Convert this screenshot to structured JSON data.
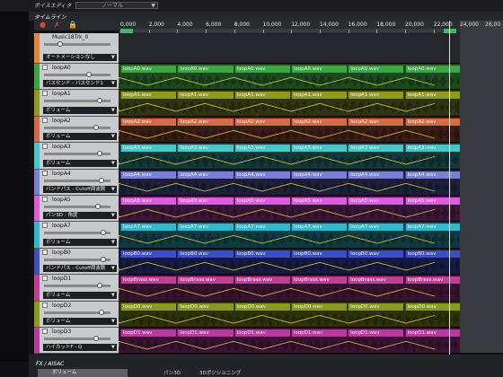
{
  "topbar": {
    "label": "ボイスエディタ",
    "combo_value": "ノーマル"
  },
  "timeline": {
    "title": "タイムライン"
  },
  "ruler": {
    "ticks": [
      "0,000",
      "2,000",
      "4,000",
      "6,000",
      "8,000",
      "10,000",
      "12,000",
      "14,000",
      "16,000",
      "18,000",
      "20,000",
      "22,000",
      "24,000",
      "26,00"
    ]
  },
  "right_ticks": [
    "24,000",
    "26,00"
  ],
  "master": {
    "name": "Music18Trk_0",
    "automation": "オートメーションなし",
    "color": "#e0843a"
  },
  "tracks": [
    {
      "name": "loopA0",
      "param": "バスセンド - バスセンド1",
      "clip": "loopA0.wav",
      "color": "#3aa542",
      "lane_bg": "#1b4a1f"
    },
    {
      "name": "loopA1",
      "param": "ボリューム",
      "clip": "loopA1.wav",
      "color": "#8c9a1e",
      "lane_bg": "#2e3510"
    },
    {
      "name": "loopA2",
      "param": "ボリューム",
      "clip": "loopA2.wav",
      "color": "#d36a4a",
      "lane_bg": "#3b1c16"
    },
    {
      "name": "loopA3",
      "param": "ボリューム",
      "clip": "loopA3.wav",
      "color": "#45c7c7",
      "lane_bg": "#123838"
    },
    {
      "name": "loopA4",
      "param": "バンドパス - Cutoff周波数",
      "clip": "loopA4.wav",
      "color": "#7a7fd8",
      "lane_bg": "#1e1f3c"
    },
    {
      "name": "loopA5",
      "param": "パン3D - 角度",
      "clip": "loopA5.wav",
      "color": "#e05bd8",
      "lane_bg": "#3c1638"
    },
    {
      "name": "loopA7",
      "param": "ボリューム",
      "clip": "loopA7.wav",
      "color": "#2fb8cf",
      "lane_bg": "#0f3a42"
    },
    {
      "name": "loopB0",
      "param": "バンドパス - Cutoff周波数",
      "clip": "loopB0.wav",
      "color": "#3d4fc2",
      "lane_bg": "#141a42"
    },
    {
      "name": "loopD1",
      "param": "ボリューム",
      "clip": "loopBrass.wav",
      "color": "#c23e94",
      "lane_bg": "#3a1230"
    },
    {
      "name": "loopD2",
      "param": "ボリューム",
      "clip": "loopD0.wav",
      "color": "#8a9a1d",
      "lane_bg": "#2d320c"
    },
    {
      "name": "loopD3",
      "param": "ハイカットF - Q",
      "clip": "loopD1.wav",
      "color": "#b83aa0",
      "lane_bg": "#3a1234"
    }
  ],
  "bottom": {
    "title": "FX / AISAC",
    "volume": "ボリューム",
    "pan": "パン3D",
    "pos3d": "3Dポジショニング"
  }
}
